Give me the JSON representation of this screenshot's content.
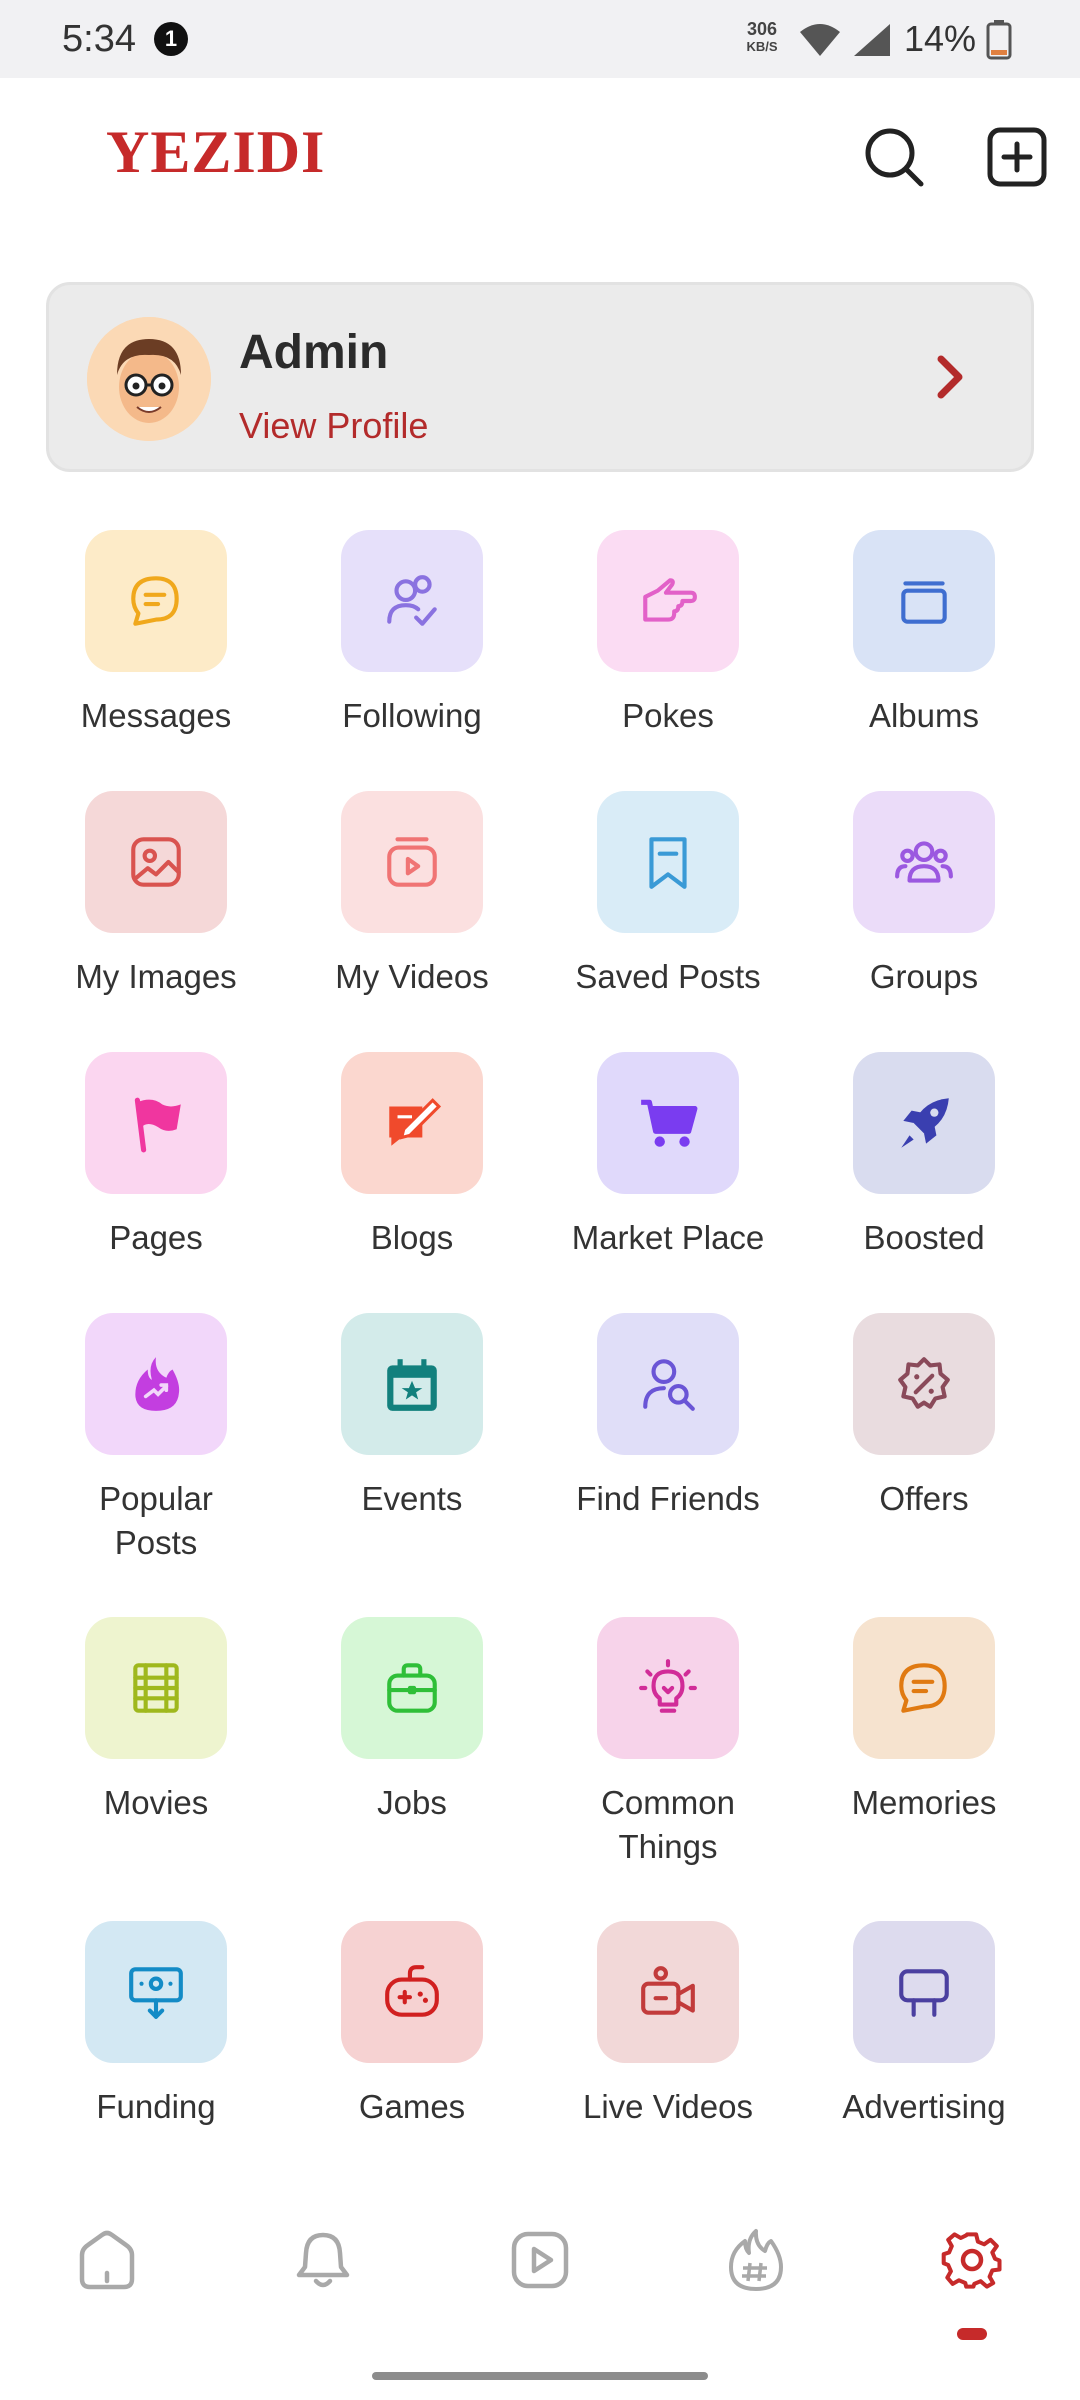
{
  "status_bar": {
    "time": "5:34",
    "notification_count": "1",
    "net_speed_value": "306",
    "net_speed_unit": "KB/S",
    "battery": "14%"
  },
  "header": {
    "brand": "YEZIDI",
    "search_icon": "search-icon",
    "create_icon": "plus-square-icon"
  },
  "profile": {
    "name": "Admin",
    "link": "View Profile"
  },
  "menu": [
    {
      "label": "Messages",
      "icon": "chat-icon",
      "bg": "#fdebc8",
      "color": "#f0a81c"
    },
    {
      "label": "Following",
      "icon": "user-check-icon",
      "bg": "#e6e0fa",
      "color": "#8a72e0"
    },
    {
      "label": "Pokes",
      "icon": "hand-point-icon",
      "bg": "#fbdcf3",
      "color": "#e261c8"
    },
    {
      "label": "Albums",
      "icon": "album-icon",
      "bg": "#d9e3f6",
      "color": "#3f6ed0"
    },
    {
      "label": "My Images",
      "icon": "image-icon",
      "bg": "#f5d8d8",
      "color": "#d9534f"
    },
    {
      "label": "My Videos",
      "icon": "video-icon",
      "bg": "#fbe0e0",
      "color": "#f07474"
    },
    {
      "label": "Saved Posts",
      "icon": "bookmark-icon",
      "bg": "#d9ecf7",
      "color": "#3a9ad6"
    },
    {
      "label": "Groups",
      "icon": "groups-icon",
      "bg": "#ebdcf9",
      "color": "#9b58e0"
    },
    {
      "label": "Pages",
      "icon": "flag-icon",
      "bg": "#fbd6f0",
      "color": "#f0369f"
    },
    {
      "label": "Blogs",
      "icon": "blog-icon",
      "bg": "#fbd7cf",
      "color": "#f04a2c"
    },
    {
      "label": "Market Place",
      "icon": "cart-icon",
      "bg": "#e0d9fb",
      "color": "#7a3cf0"
    },
    {
      "label": "Boosted",
      "icon": "rocket-icon",
      "bg": "#d9dcef",
      "color": "#3a3fb0"
    },
    {
      "label": "Popular Posts",
      "icon": "fire-icon",
      "bg": "#f2d7fa",
      "color": "#c33ee0"
    },
    {
      "label": "Events",
      "icon": "calendar-icon",
      "bg": "#d3ebea",
      "color": "#12807d"
    },
    {
      "label": "Find Friends",
      "icon": "find-user-icon",
      "bg": "#e0def8",
      "color": "#6a55d6"
    },
    {
      "label": "Offers",
      "icon": "discount-icon",
      "bg": "#e9dcdf",
      "color": "#8a4a5a"
    },
    {
      "label": "Movies",
      "icon": "film-icon",
      "bg": "#eef4cf",
      "color": "#9fb81d"
    },
    {
      "label": "Jobs",
      "icon": "briefcase-icon",
      "bg": "#d6f7d6",
      "color": "#2fbf38"
    },
    {
      "label": "Common Things",
      "icon": "bulb-icon",
      "bg": "#f7d3ea",
      "color": "#d12c98"
    },
    {
      "label": "Memories",
      "icon": "chat-bubble-icon",
      "bg": "#f6e3cf",
      "color": "#e07a12"
    },
    {
      "label": "Funding",
      "icon": "funding-icon",
      "bg": "#d3e8f3",
      "color": "#138bc6"
    },
    {
      "label": "Games",
      "icon": "gamepad-icon",
      "bg": "#f6d2d2",
      "color": "#d12020"
    },
    {
      "label": "Live Videos",
      "icon": "live-camera-icon",
      "bg": "#f2d8d8",
      "color": "#c23b3b"
    },
    {
      "label": "Advertising",
      "icon": "billboard-icon",
      "bg": "#dddbee",
      "color": "#4a3fa0"
    }
  ],
  "nav": [
    {
      "icon": "home-icon",
      "active": false
    },
    {
      "icon": "bell-icon",
      "active": false
    },
    {
      "icon": "play-icon",
      "active": false
    },
    {
      "icon": "trending-hashtag-icon",
      "active": false
    },
    {
      "icon": "settings-gear-icon",
      "active": true
    }
  ],
  "colors": {
    "accent": "#c62a2a",
    "nav_inactive": "#a9a9a9"
  }
}
